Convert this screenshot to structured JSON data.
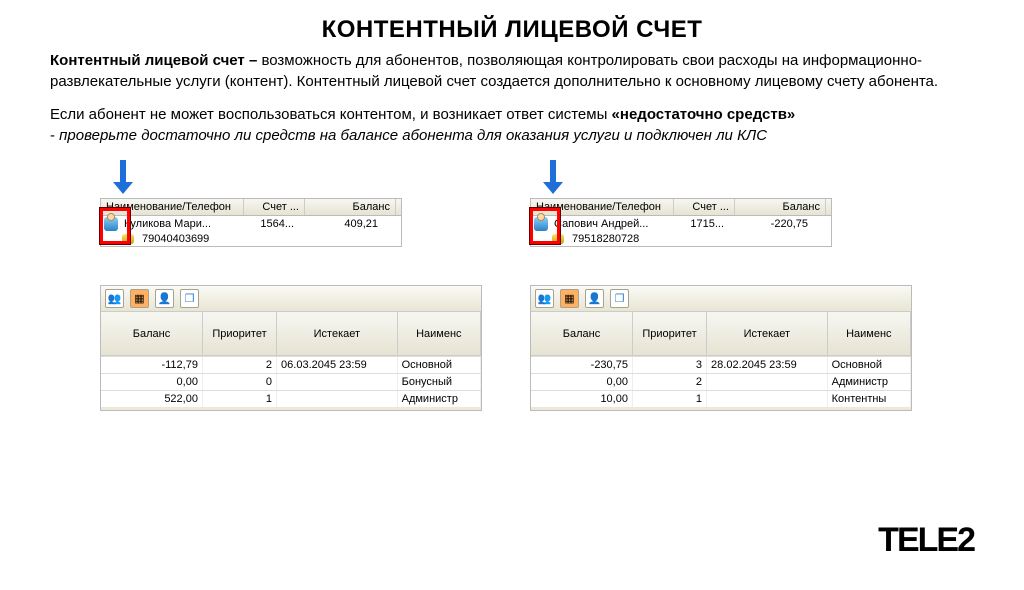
{
  "title": "КОНТЕНТНЫЙ ЛИЦЕВОЙ СЧЕТ",
  "desc": {
    "lead_bold": "Контентный лицевой счет – ",
    "p1": "возможность для абонентов, позволяющая контролировать свои расходы на информационно-развлекательные услуги (контент). Контентный лицевой счет создается дополнительно к основному лицевому счету абонента.",
    "p2_plain": "Если абонент не может воспользоваться контентом, и возникает ответ системы ",
    "p2_bold": "«недостаточно средств»",
    "p3_dash": "- ",
    "p3_italic": "проверьте достаточно ли средств на балансе абонента для оказания услуги и подключен ли КЛС"
  },
  "headers": {
    "name": "Наименование/Телефон",
    "account": "Счет ...",
    "balance": "Баланс"
  },
  "grid_headers": {
    "balance": "Баланс",
    "priority": "Приоритет",
    "expires": "Истекает",
    "name": "Наименс"
  },
  "logo": "TELE2",
  "left": {
    "subscriber": "Куликова Мари...",
    "account": "1564...",
    "balance": "409,21",
    "phone": "79040403699",
    "rows": [
      {
        "balance": "-112,79",
        "priority": "2",
        "expires": "06.03.2045 23:59",
        "name": "Основной"
      },
      {
        "balance": "0,00",
        "priority": "0",
        "expires": "",
        "name": "Бонусный"
      },
      {
        "balance": "522,00",
        "priority": "1",
        "expires": "",
        "name": "Администр"
      }
    ]
  },
  "right": {
    "subscriber": "Сапович Андрей...",
    "account": "1715...",
    "balance": "-220,75",
    "phone": "79518280728",
    "rows": [
      {
        "balance": "-230,75",
        "priority": "3",
        "expires": "28.02.2045 23:59",
        "name": "Основной"
      },
      {
        "balance": "0,00",
        "priority": "2",
        "expires": "",
        "name": "Администр"
      },
      {
        "balance": "10,00",
        "priority": "1",
        "expires": "",
        "name": "Контентны"
      }
    ]
  }
}
